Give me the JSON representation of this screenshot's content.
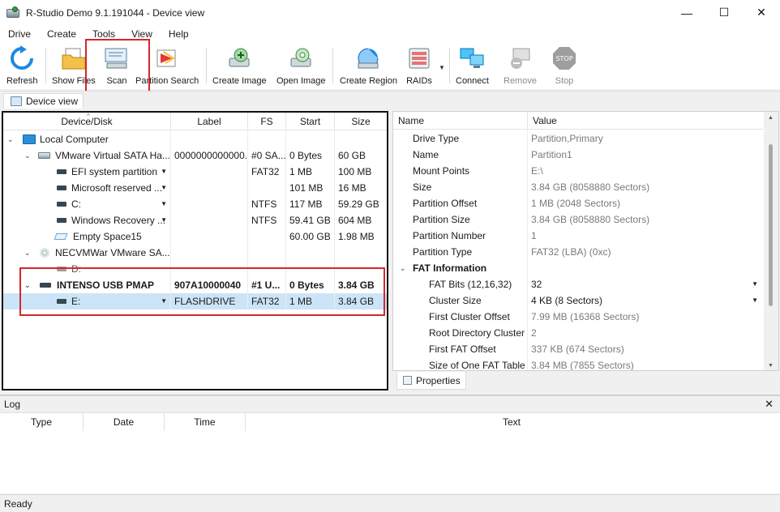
{
  "window": {
    "title": "R-Studio Demo 9.1.191044 - Device view",
    "controls": [
      "—",
      "☐",
      "✕"
    ]
  },
  "menu": [
    "Drive",
    "Create",
    "Tools",
    "View",
    "Help"
  ],
  "toolbar": {
    "refresh": "Refresh",
    "show_files": "Show Files",
    "scan": "Scan",
    "partition_search": "Partition Search",
    "create_image": "Create Image",
    "open_image": "Open Image",
    "create_region": "Create Region",
    "raids": "RAIDs",
    "connect": "Connect",
    "remove": "Remove",
    "stop": "Stop"
  },
  "breadcrumb": {
    "label": "Device view"
  },
  "tree": {
    "columns": [
      "Device/Disk",
      "Label",
      "FS",
      "Start",
      "Size"
    ],
    "rows": [
      {
        "name": "Local Computer",
        "label": "",
        "fs": "",
        "start": "",
        "size": ""
      },
      {
        "name": "VMware Virtual SATA Ha...",
        "label": "0000000000000...",
        "fs": "#0 SA...",
        "start": "0 Bytes",
        "size": "60 GB"
      },
      {
        "name": "EFI system partition",
        "label": "",
        "fs": "FAT32",
        "start": "1 MB",
        "size": "100 MB"
      },
      {
        "name": "Microsoft reserved ...",
        "label": "",
        "fs": "",
        "start": "101 MB",
        "size": "16 MB"
      },
      {
        "name": "C:",
        "label": "",
        "fs": "NTFS",
        "start": "117 MB",
        "size": "59.29 GB"
      },
      {
        "name": "Windows Recovery ...",
        "label": "",
        "fs": "NTFS",
        "start": "59.41 GB",
        "size": "604 MB"
      },
      {
        "name": "Empty Space15",
        "label": "",
        "fs": "",
        "start": "60.00 GB",
        "size": "1.98 MB"
      },
      {
        "name": "NECVMWar VMware SA...",
        "label": "",
        "fs": "",
        "start": "",
        "size": ""
      },
      {
        "name": "D:",
        "label": "",
        "fs": "",
        "start": "",
        "size": ""
      },
      {
        "name": "INTENSO USB PMAP",
        "label": "907A10000040",
        "fs": "#1 U...",
        "start": "0 Bytes",
        "size": "3.84 GB"
      },
      {
        "name": "E:",
        "label": "FLASHDRIVE",
        "fs": "FAT32",
        "start": "1 MB",
        "size": "3.84 GB"
      }
    ]
  },
  "properties": {
    "columns": [
      "Name",
      "Value"
    ],
    "rows": [
      {
        "name": "Drive Type",
        "value": "Partition,Primary"
      },
      {
        "name": "Name",
        "value": "Partition1"
      },
      {
        "name": "Mount Points",
        "value": "E:\\"
      },
      {
        "name": "Size",
        "value": "3.84 GB (8058880 Sectors)"
      },
      {
        "name": "Partition Offset",
        "value": "1 MB (2048 Sectors)"
      },
      {
        "name": "Partition Size",
        "value": "3.84 GB (8058880 Sectors)"
      },
      {
        "name": "Partition Number",
        "value": "1"
      },
      {
        "name": "Partition Type",
        "value": "FAT32 (LBA) (0xc)"
      },
      {
        "name": "FAT Information",
        "value": ""
      },
      {
        "name": "FAT Bits (12,16,32)",
        "value": "32"
      },
      {
        "name": "Cluster Size",
        "value": "4 KB (8 Sectors)"
      },
      {
        "name": "First Cluster Offset",
        "value": "7.99 MB (16368 Sectors)"
      },
      {
        "name": "Root Directory Cluster",
        "value": "2"
      },
      {
        "name": "First FAT Offset",
        "value": "337 KB (674 Sectors)"
      },
      {
        "name": "Size of One FAT Table",
        "value": "3.84 MB (7855 Sectors)"
      }
    ],
    "tab": "Properties"
  },
  "log": {
    "title": "Log",
    "close": "✕",
    "columns": [
      "Type",
      "Date",
      "Time",
      "Text"
    ]
  },
  "status": {
    "text": "Ready"
  },
  "colors": {
    "highlight_red": "#d3272d",
    "selection": "#cce4f7"
  }
}
